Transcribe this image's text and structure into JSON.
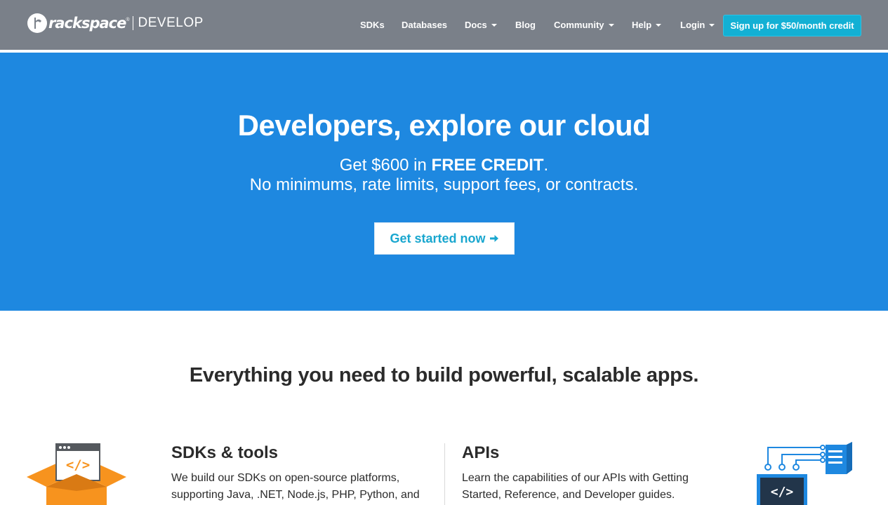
{
  "header": {
    "logo_text": "rackspace",
    "logo_reg": "®",
    "logo_sub": "DEVELOP",
    "nav": [
      {
        "label": "SDKs",
        "dropdown": false
      },
      {
        "label": "Databases",
        "dropdown": false
      },
      {
        "label": "Docs",
        "dropdown": true
      },
      {
        "label": "Blog",
        "dropdown": false
      },
      {
        "label": "Community",
        "dropdown": true
      },
      {
        "label": "Help",
        "dropdown": true
      },
      {
        "label": "Login",
        "dropdown": true
      }
    ],
    "signup_label": "Sign up for $50/month credit"
  },
  "hero": {
    "title": "Developers, explore our cloud",
    "line1_prefix": "Get $600 in ",
    "line1_bold": "FREE CREDIT",
    "line1_suffix": ".",
    "line2": "No minimums, rate limits, support fees, or contracts.",
    "cta_label": "Get started now"
  },
  "features": {
    "title": "Everything you need to build powerful, scalable apps.",
    "sdks": {
      "heading": "SDKs & tools",
      "line1": "We build our SDKs on open-source platforms,",
      "line2": "supporting Java, .NET, Node.js, PHP, Python, and",
      "icon": "code-box-icon"
    },
    "apis": {
      "heading": "APIs",
      "line1": "Learn the capabilities of our APIs with Getting",
      "line2": "Started, Reference, and Developer guides.",
      "icon": "api-server-icon"
    }
  },
  "colors": {
    "nav_bg": "#7a8089",
    "hero_bg": "#1e88e0",
    "accent": "#13b0d4",
    "orange": "#f7931e"
  }
}
